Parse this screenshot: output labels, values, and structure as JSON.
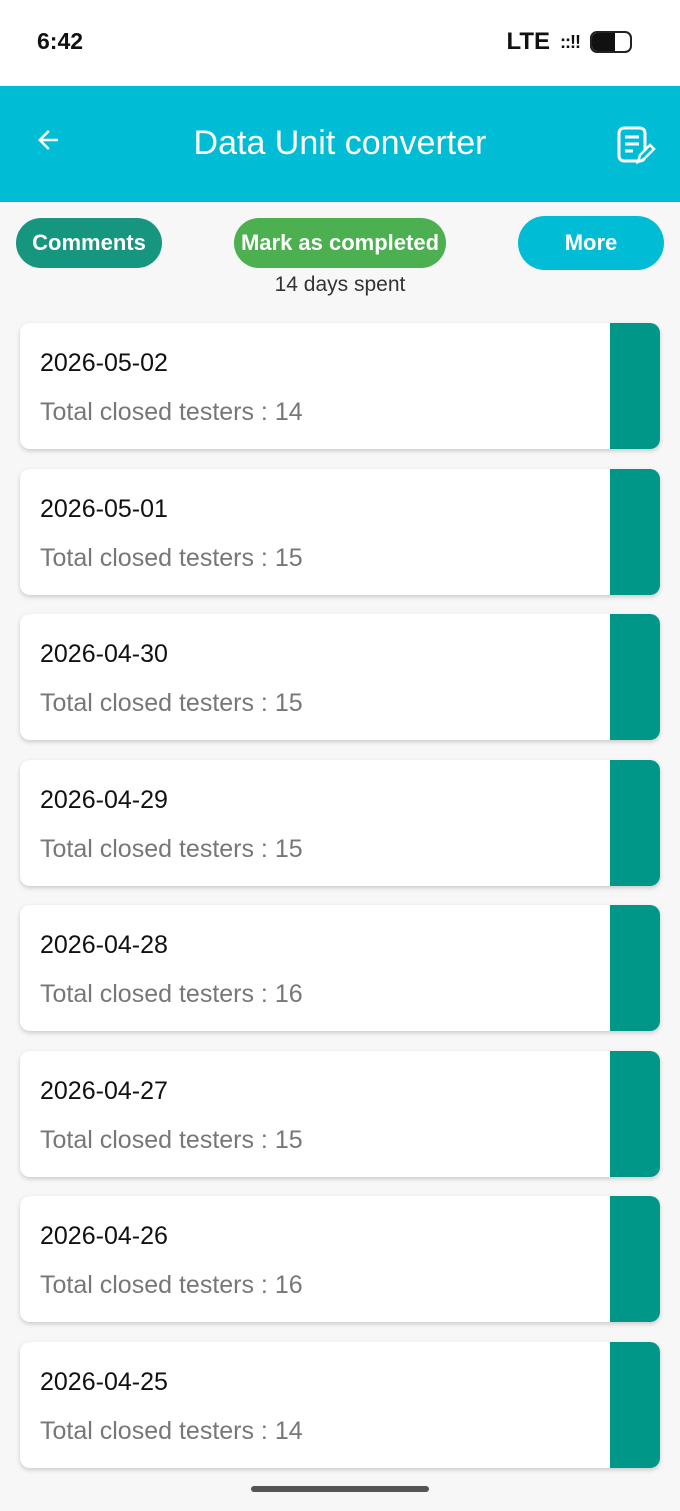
{
  "status_bar": {
    "time": "6:42",
    "network": "LTE",
    "signal": "::!!",
    "battery_level": 0.6
  },
  "app_bar": {
    "title": "Data Unit converter",
    "back_icon": "arrow-left-icon",
    "action_icon": "edit-note-icon",
    "color": "#00bcd4"
  },
  "actions": {
    "comments_label": "Comments",
    "mark_completed_label": "Mark as completed",
    "more_label": "More"
  },
  "days_spent": "14 days spent",
  "entries": [
    {
      "date": "2026-05-02",
      "testers": "Total closed testers : 14"
    },
    {
      "date": "2026-05-01",
      "testers": "Total closed testers : 15"
    },
    {
      "date": "2026-04-30",
      "testers": "Total closed testers : 15"
    },
    {
      "date": "2026-04-29",
      "testers": "Total closed testers : 15"
    },
    {
      "date": "2026-04-28",
      "testers": "Total closed testers : 16"
    },
    {
      "date": "2026-04-27",
      "testers": "Total closed testers : 15"
    },
    {
      "date": "2026-04-26",
      "testers": "Total closed testers : 16"
    },
    {
      "date": "2026-04-25",
      "testers": "Total closed testers : 14"
    }
  ],
  "colors": {
    "accent": "#00bcd4",
    "teal_strip": "#009688",
    "comments_button": "#16967f",
    "mark_button": "#4caf50"
  }
}
